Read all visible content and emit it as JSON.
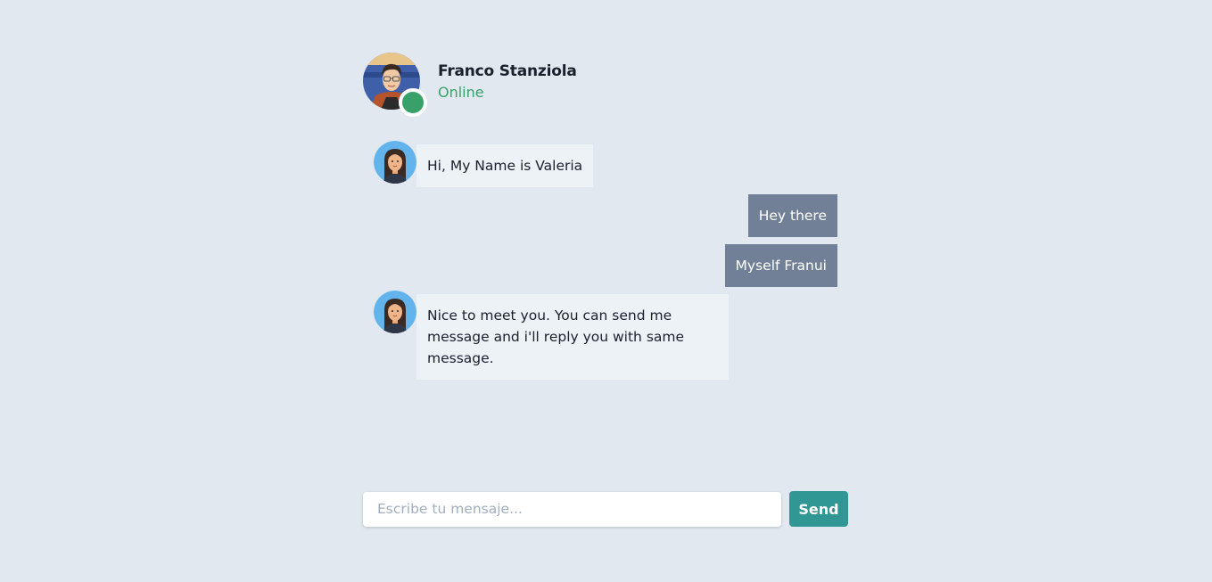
{
  "header": {
    "contact_name": "Franco Stanziola",
    "contact_status": "Online"
  },
  "messages": [
    {
      "from": "bot",
      "text": "Hi, My Name is Valeria"
    },
    {
      "from": "user",
      "text": "Hey there"
    },
    {
      "from": "user",
      "text": "Myself Franui"
    },
    {
      "from": "bot",
      "text": "Nice to meet you. You can send me message and i'll reply you with same message."
    }
  ],
  "composer": {
    "placeholder": "Escribe tu mensaje...",
    "value": "",
    "send_label": "Send"
  },
  "colors": {
    "background": "#e2e8f0",
    "online": "#38a169",
    "bot_bubble": "#edf2f7",
    "user_bubble": "#718096",
    "send_button": "#319795"
  },
  "icons": {
    "contact_avatar": "contact-avatar-photo",
    "bot_avatar": "bot-avatar-illustration",
    "status": "online-status-dot"
  }
}
